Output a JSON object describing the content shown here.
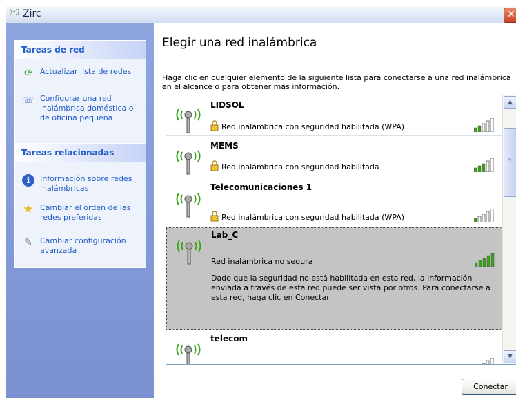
{
  "window": {
    "title": "Zirc",
    "icon": "wireless-signal-icon",
    "close_glyph": "✕"
  },
  "sidebar": {
    "network_tasks": {
      "header": "Tareas de red",
      "items": [
        {
          "label": "Actualizar lista de redes",
          "icon": "refresh-icon"
        },
        {
          "label": "Configurar una red inalámbrica doméstica o de oficina pequeña",
          "icon": "wireless-setup-icon"
        }
      ]
    },
    "related_tasks": {
      "header": "Tareas relacionadas",
      "items": [
        {
          "label": "Información sobre redes inalámbricas",
          "icon": "info-icon"
        },
        {
          "label": "Cambiar el orden de las redes preferidas",
          "icon": "star-icon"
        },
        {
          "label": "Cambiar configuración avanzada",
          "icon": "settings-icon"
        }
      ]
    }
  },
  "main": {
    "title": "Elegir una red inalámbrica",
    "description": "Haga clic en cualquier elemento de la siguiente lista para conectarse a una red inalámbrica en el alcance o para obtener más información.",
    "networks": [
      {
        "name": "LIDSOL",
        "security": "Red inalámbrica con seguridad habilitada (WPA)",
        "secured": true,
        "signal_bars": 2
      },
      {
        "name": "MEMS",
        "security": "Red inalámbrica con seguridad habilitada",
        "secured": true,
        "signal_bars": 3
      },
      {
        "name": "Telecomunicaciones 1",
        "security": "Red inalámbrica con seguridad habilitada (WPA)",
        "secured": true,
        "signal_bars": 1
      },
      {
        "name": "Lab_C",
        "security": "Red inalámbrica no segura",
        "secured": false,
        "signal_bars": 5,
        "selected": true,
        "details": "Dado que la seguridad no está habilitada en esta red, la información enviada a través de esta red puede ser vista por otros. Para conectarse a esta red, haga clic en Conectar."
      },
      {
        "name": "telecom",
        "security": "",
        "secured": false,
        "signal_bars": 1
      }
    ],
    "connect_label": "Conectar"
  },
  "colors": {
    "sidebar_bg": "#7a91d2",
    "panel_header_text": "#215dc6",
    "link_text": "#215dc6",
    "signal_on": "#3fa21c",
    "antenna_wave": "#39a21a",
    "selected_row": "#c4c4c4"
  }
}
